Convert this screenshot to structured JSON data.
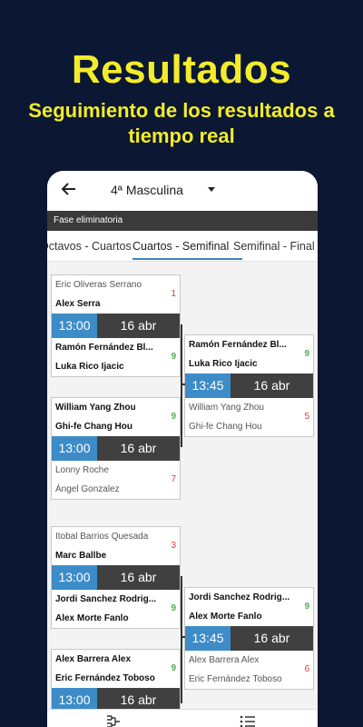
{
  "promo": {
    "title": "Resultados",
    "subtitle": "Seguimiento de los resultados a tiempo real"
  },
  "app_bar": {
    "category": "4ª Masculina",
    "back_icon": "arrow-left-icon",
    "dropdown_icon": "caret-down-icon"
  },
  "phase": "Fase eliminatoria",
  "tabs": [
    "Octavos - Cuartos",
    "Cuartos - Semifinal",
    "Semifinal - Final"
  ],
  "active_tab": 1,
  "colors": {
    "background": "#0b1733",
    "accent_yellow": "#f2ec2b",
    "time_blue": "#3d8cc8",
    "date_dark": "#404040",
    "score_win": "#4caf50",
    "score_lose": "#e53935"
  },
  "matches": {
    "m1": {
      "top": {
        "p1": "Eric Oliveras Serrano",
        "p2": "Alex Serra",
        "score": "1"
      },
      "time": "13:00",
      "date": "16 abr",
      "bottom": {
        "p1": "Ramón Fernández Bl...",
        "p2": "Luka Rico Ijacic",
        "score": "9"
      }
    },
    "m2": {
      "top": {
        "p1": "William Yang Zhou",
        "p2": "Ghi-fe Chang Hou",
        "score": "9"
      },
      "time": "13:00",
      "date": "16 abr",
      "bottom": {
        "p1": "Lonny Roche",
        "p2": "Ángel Gonzalez",
        "score": "7"
      }
    },
    "m3": {
      "top": {
        "p1": "Itobal Barrios Quesada",
        "p2": "Marc Ballbe",
        "score": "3"
      },
      "time": "13:00",
      "date": "16 abr",
      "bottom": {
        "p1": "Jordi Sanchez Rodrig...",
        "p2": "Alex Morte Fanlo",
        "score": "9"
      }
    },
    "m4": {
      "top": {
        "p1": "Alex Barrera Alex",
        "p2": "Eric Fernández Toboso",
        "score": "9"
      },
      "time": "13:00",
      "date": "16 abr"
    },
    "s1": {
      "top": {
        "p1": "Ramón Fernández Bl...",
        "p2": "Luka Rico Ijacic",
        "score": "9"
      },
      "time": "13:45",
      "date": "16 abr",
      "bottom": {
        "p1": "William Yang Zhou",
        "p2": "Ghi-fe Chang Hou",
        "score": "5"
      }
    },
    "s2": {
      "top": {
        "p1": "Jordi Sanchez Rodrig...",
        "p2": "Alex Morte Fanlo",
        "score": "9"
      },
      "time": "13:45",
      "date": "16 abr",
      "bottom": {
        "p1": "Alex Barrera Alex",
        "p2": "Eric Fernández Toboso",
        "score": "6"
      }
    }
  },
  "bottom_nav": {
    "left_icon": "bracket-icon",
    "right_icon": "list-icon"
  }
}
